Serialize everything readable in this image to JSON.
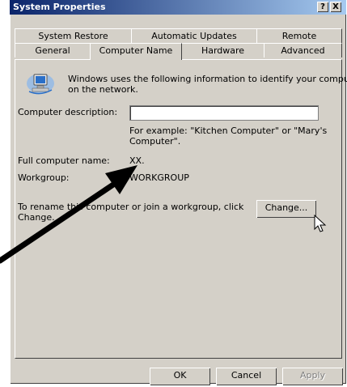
{
  "window": {
    "title": "System Properties",
    "help_label": "?",
    "close_label": "X"
  },
  "tabs_row1": [
    "System Restore",
    "Automatic Updates",
    "Remote"
  ],
  "tabs_row2": [
    "General",
    "Computer Name",
    "Hardware",
    "Advanced"
  ],
  "active_tab": "Computer Name",
  "panel": {
    "intro_line1": "Windows uses the following information to identify your computer",
    "intro_line2": "on the network.",
    "description_label": "Computer description:",
    "description_value": "",
    "example_line1": "For example: \"Kitchen Computer\" or \"Mary's",
    "example_line2": "Computer\".",
    "full_name_label": "Full computer name:",
    "full_name_value": "XX.",
    "workgroup_label": "Workgroup:",
    "workgroup_value": "WORKGROUP",
    "rename_line1": "To rename this computer or join a workgroup, click",
    "rename_line2": "Change.",
    "change_button": "Change..."
  },
  "buttons": {
    "ok": "OK",
    "cancel": "Cancel",
    "apply": "Apply"
  },
  "icons": {
    "computer": "computer-network-icon",
    "cursor": "mouse-pointer-icon",
    "arrow": "black-arrow-annotation"
  }
}
